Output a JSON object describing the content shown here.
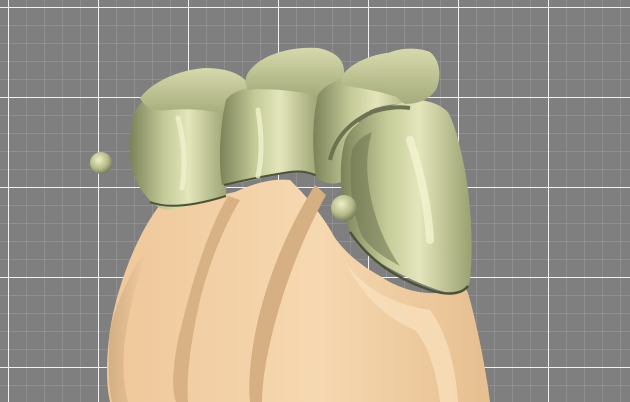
{
  "viewport": {
    "background_color": "#7f7f7f",
    "grid_minor_color": "#9c9c9c",
    "grid_major_color": "#f2f2f2"
  },
  "model": {
    "gingiva_color": "#f3cfa3",
    "gingiva_shadow_color": "#d3ae84",
    "crown_color": "#b9bf8c",
    "crown_shadow_color": "#6d7350",
    "crown_highlight_color": "#eef0c8",
    "margin_line_color": "#4d5336"
  }
}
